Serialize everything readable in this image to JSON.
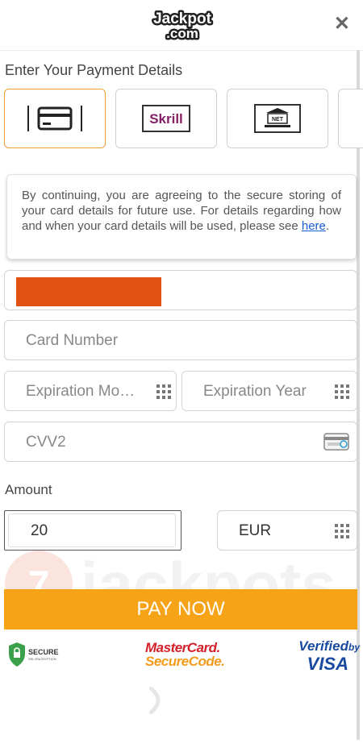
{
  "header": {
    "logo_text": "Jackpot.com",
    "close_icon": "close-icon"
  },
  "payment": {
    "section_title": "Enter Your Payment Details",
    "methods": [
      {
        "name": "card",
        "icon": "credit-card-icon",
        "selected": true
      },
      {
        "name": "skrill",
        "label": "Skrill",
        "icon": "skrill-logo"
      },
      {
        "name": "netbanking",
        "label": "NET",
        "icon": "bank-icon"
      },
      {
        "name": "more",
        "icon": "partial-method"
      }
    ],
    "notice": {
      "text": "By continuing, you are agreeing to the secure storing of your card details for future use. For details regarding how and when your card details will be used, please see ",
      "link": "here",
      "suffix": "."
    },
    "fields": {
      "card_number_placeholder": "Card Number",
      "exp_month_placeholder": "Expiration Mo…",
      "exp_year_placeholder": "Expiration Year",
      "cvv_placeholder": "CVV2"
    },
    "amount": {
      "label": "Amount",
      "value": "20",
      "currency": "EUR"
    },
    "pay_button": "PAY NOW",
    "watermark_text": "jackpots",
    "badges": {
      "secure_label": "SECURE",
      "secure_sub": "SSL ENCRYPTION",
      "mastercard_line1": "MasterCard.",
      "mastercard_line2": "SecureCode.",
      "visa_line1": "Verified",
      "visa_line1_small": "by",
      "visa_line2": "VISA"
    }
  },
  "colors": {
    "accent_orange": "#f7a318",
    "redacted_bar": "#e25212",
    "link_blue": "#1a5dd6"
  }
}
